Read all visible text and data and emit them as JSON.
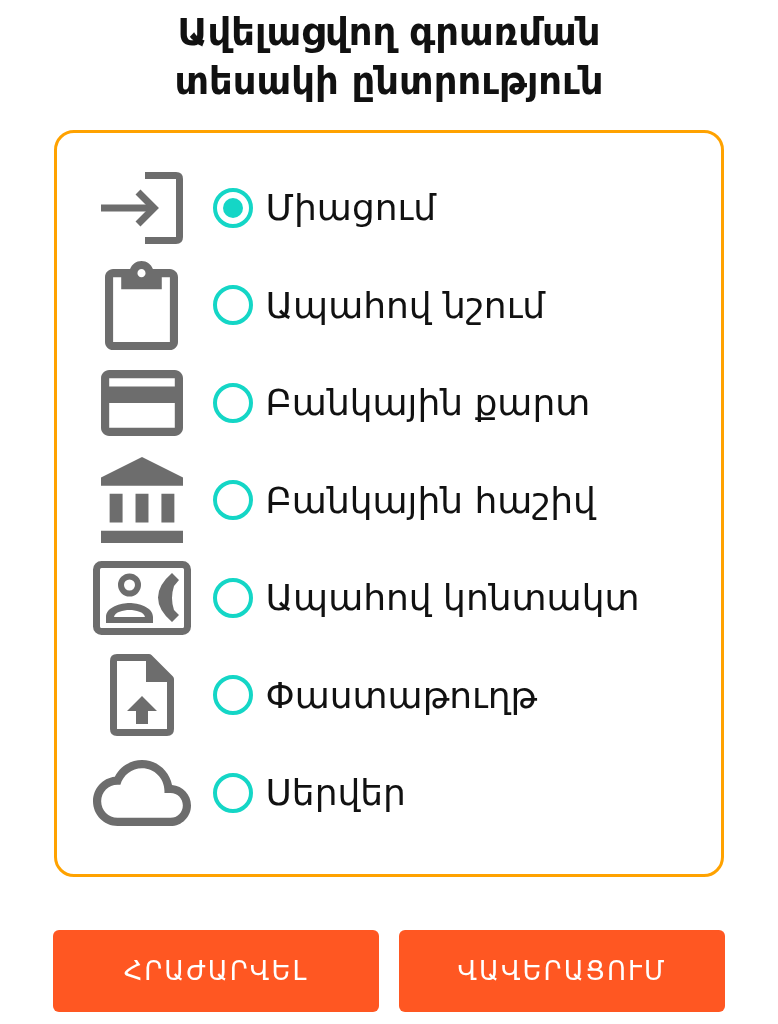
{
  "title": "Ավելացվող գրառման տեսակի ընտրություն",
  "options": [
    {
      "kind": "connection",
      "label": "Միացում",
      "selected": true
    },
    {
      "kind": "note",
      "label": "Ապահով նշում",
      "selected": false
    },
    {
      "kind": "card",
      "label": "Բանկային քարտ",
      "selected": false
    },
    {
      "kind": "account",
      "label": "Բանկային հաշիվ",
      "selected": false
    },
    {
      "kind": "contact",
      "label": "Ապահով կոնտակտ",
      "selected": false
    },
    {
      "kind": "document",
      "label": "Փաստաթուղթ",
      "selected": false
    },
    {
      "kind": "server",
      "label": "Սերվեր",
      "selected": false
    }
  ],
  "buttons": [
    {
      "label": "ՀՐԱԺԱՐՎԵԼ"
    },
    {
      "label": "ՎԱՎԵՐԱՑՈՒՄ"
    }
  ]
}
